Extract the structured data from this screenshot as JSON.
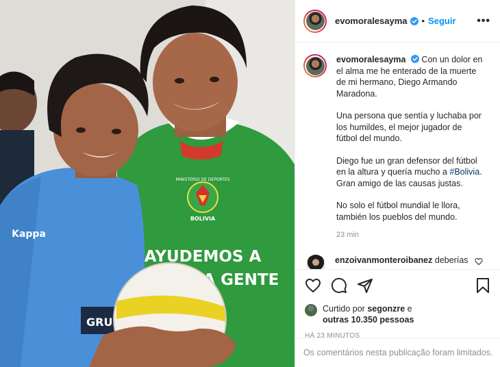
{
  "post": {
    "username": "evomoralesayma",
    "separator": "•",
    "follow_label": "Seguir",
    "more_label": "•••"
  },
  "caption": {
    "username": "evomoralesayma",
    "p1": "Con un dolor en el alma me he enterado de la muerte de mi hermano, Diego Armando Maradona.",
    "p2": "Una persona que sentía y luchaba por los humildes, el mejor jugador de fútbol del mundo.",
    "p3_before": "Diego fue un gran defensor del fútbol en la altura y quería mucho a ",
    "p3_hashtag": "#Bolivia",
    "p3_after": ". Gran amigo de las causas justas.",
    "p4": "No solo el fútbol mundial le llora, también los pueblos del mundo.",
    "time": "23 min"
  },
  "comment": {
    "username": "enzoivanmonteroibanez",
    "text": "deberías"
  },
  "likes": {
    "prefix": "Curtido por ",
    "user": "segonzre",
    "middle": " e",
    "others": "outras 10.350 pessoas"
  },
  "timestamp": "HÁ 23 MINUTOS",
  "comments_limited": "Os comentários nesta publicação foram limitados.",
  "photo": {
    "shirt_line1": "AYUDEMOS A",
    "shirt_line2": "NUESTRA GENTE",
    "crest_text": "BOLIVIA",
    "crest_top": "MINISTERIO DE DEPORTES",
    "kappa_text": "Kappa",
    "sleeve_text": "GRU"
  },
  "colors": {
    "accent": "#0095f6",
    "green_shirt": "#2f9a3e",
    "blue_shirt": "#4a90d9",
    "muted": "#8e8e8e"
  },
  "icons": [
    "verified-badge-icon",
    "more-options-icon",
    "heart-icon",
    "comment-icon",
    "share-icon",
    "bookmark-icon",
    "small-heart-icon"
  ]
}
